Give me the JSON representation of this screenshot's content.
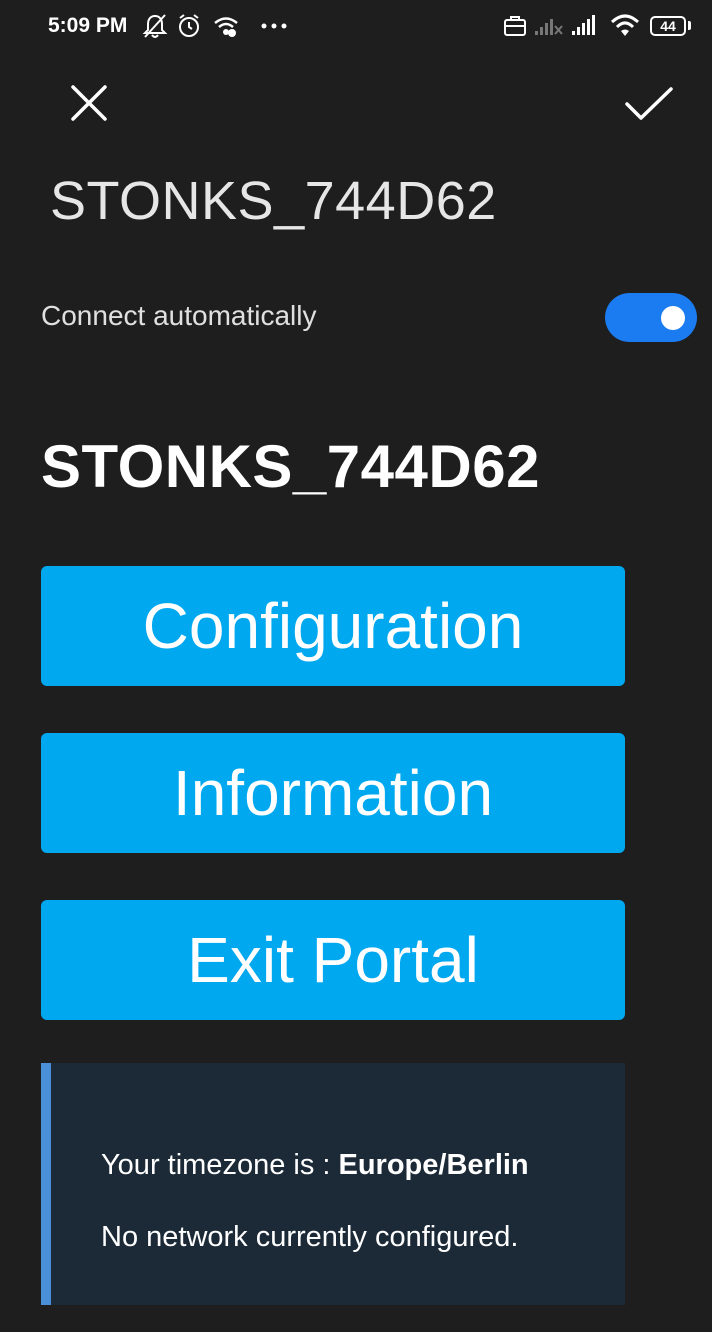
{
  "status_bar": {
    "time": "5:09 PM",
    "battery": "44",
    "icons": [
      "muted-notification-icon",
      "alarm-icon",
      "wifi-small-icon",
      "more-dots-icon",
      "briefcase-icon",
      "signal-off-icon",
      "signal-icon",
      "wifi-icon",
      "battery-icon"
    ]
  },
  "header": {
    "close_icon": "close-icon",
    "confirm_icon": "check-icon",
    "network_name": "STONKS_744D62"
  },
  "settings": {
    "connect_automatically_label": "Connect automatically",
    "connect_automatically_on": true,
    "toggle_color": "#1a7cf0"
  },
  "portal": {
    "title": "STONKS_744D62",
    "buttons": [
      {
        "label": "Configuration"
      },
      {
        "label": "Information"
      },
      {
        "label": "Exit Portal"
      }
    ],
    "button_color": "#00a8ef",
    "info": {
      "timezone_prefix": "Your timezone is : ",
      "timezone_value": "Europe/Berlin",
      "network_status": "No network currently configured."
    }
  }
}
